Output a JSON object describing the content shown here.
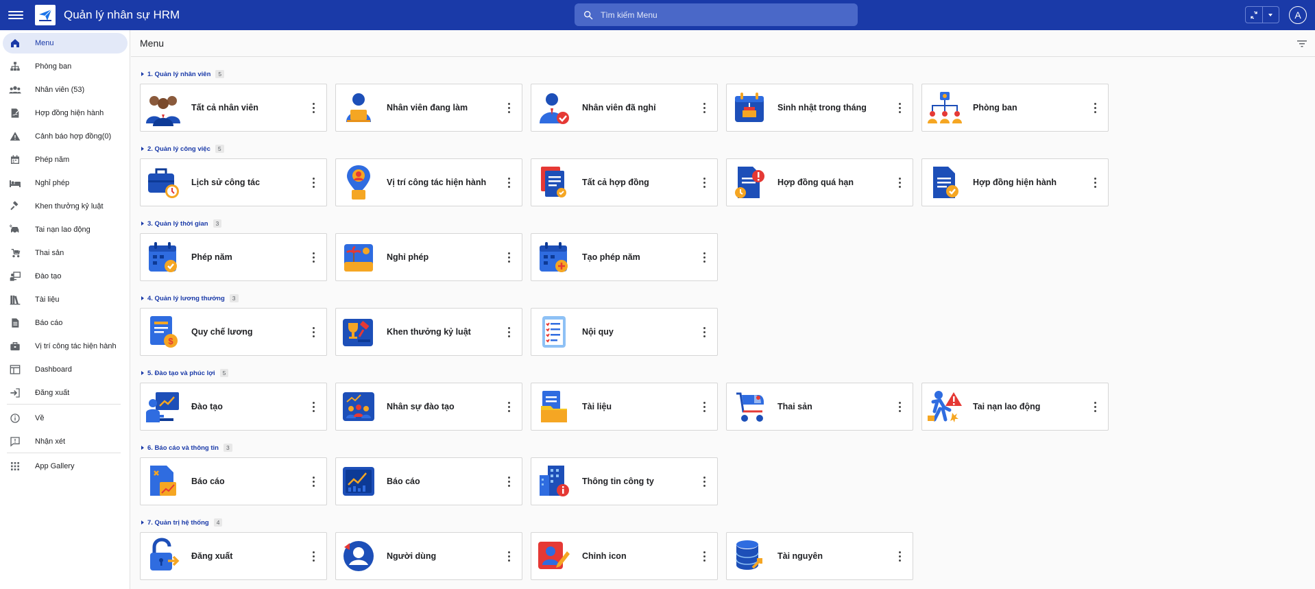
{
  "header": {
    "title": "Quản lý nhân sự HRM",
    "search_placeholder": "Tìm kiếm Menu",
    "avatar_letter": "A",
    "brand_color": "#1a3aa8"
  },
  "sidebar": {
    "items": [
      {
        "label": "Menu",
        "icon": "home-icon",
        "active": true
      },
      {
        "label": "Phòng ban",
        "icon": "org-chart-icon"
      },
      {
        "label": "Nhân viên (53)",
        "icon": "people-icon"
      },
      {
        "label": "Hợp đồng hiện hành",
        "icon": "contract-sign-icon"
      },
      {
        "label": "Cảnh báo hợp đồng(0)",
        "icon": "warning-icon"
      },
      {
        "label": "Phép năm",
        "icon": "calendar-icon"
      },
      {
        "label": "Nghỉ phép",
        "icon": "bed-icon"
      },
      {
        "label": "Khen thưởng kỷ luật",
        "icon": "gavel-icon"
      },
      {
        "label": "Tai nạn lao động",
        "icon": "car-crash-icon"
      },
      {
        "label": "Thai sản",
        "icon": "stroller-icon"
      },
      {
        "label": "Đào tạo",
        "icon": "teacher-icon"
      },
      {
        "label": "Tài liệu",
        "icon": "books-icon"
      },
      {
        "label": "Báo cáo",
        "icon": "report-icon"
      },
      {
        "label": "Vị trí công tác hiện hành",
        "icon": "briefcase-icon"
      },
      {
        "label": "Dashboard",
        "icon": "dashboard-icon"
      },
      {
        "label": "Đăng xuất",
        "icon": "logout-icon"
      }
    ],
    "footer_items": [
      {
        "label": "Về",
        "icon": "info-icon"
      },
      {
        "label": "Nhận xét",
        "icon": "feedback-icon"
      },
      {
        "label": "App Gallery",
        "icon": "apps-grid-icon"
      }
    ]
  },
  "main": {
    "title": "Menu",
    "sections": [
      {
        "title": "1. Quản lý nhân viên",
        "count": "5",
        "cards": [
          {
            "label": "Tất cả nhân viên",
            "icon": "team-icon"
          },
          {
            "label": "Nhân viên đang làm",
            "icon": "employee-laptop-icon"
          },
          {
            "label": "Nhân viên đã nghỉ",
            "icon": "employee-check-icon"
          },
          {
            "label": "Sinh nhật trong tháng",
            "icon": "birthday-calendar-icon"
          },
          {
            "label": "Phòng ban",
            "icon": "hierarchy-icon"
          }
        ]
      },
      {
        "title": "2. Quản lý công việc",
        "count": "5",
        "cards": [
          {
            "label": "Lịch sử công tác",
            "icon": "briefcase-clock-icon"
          },
          {
            "label": "Vị trí công tác hiện hành",
            "icon": "location-pin-icon"
          },
          {
            "label": "Tất cả hợp đồng",
            "icon": "documents-icon"
          },
          {
            "label": "Hợp đồng quá hạn",
            "icon": "document-overdue-icon"
          },
          {
            "label": "Hợp đồng hiện hành",
            "icon": "document-check-icon"
          }
        ]
      },
      {
        "title": "3. Quản lý thời gian",
        "count": "3",
        "cards": [
          {
            "label": "Phép năm",
            "icon": "calendar-check-icon"
          },
          {
            "label": "Nghỉ phép",
            "icon": "beach-icon"
          },
          {
            "label": "Tạo phép năm",
            "icon": "calendar-add-icon"
          }
        ]
      },
      {
        "title": "4. Quản lý lương thưởng",
        "count": "3",
        "cards": [
          {
            "label": "Quy chế lương",
            "icon": "salary-icon"
          },
          {
            "label": "Khen thưởng kỷ luật",
            "icon": "trophy-gavel-icon"
          },
          {
            "label": "Nội quy",
            "icon": "checklist-icon"
          }
        ]
      },
      {
        "title": "5. Đào tạo và phúc lợi",
        "count": "5",
        "cards": [
          {
            "label": "Đào tạo",
            "icon": "presentation-icon"
          },
          {
            "label": "Nhân sự đào tạo",
            "icon": "training-group-icon"
          },
          {
            "label": "Tài liệu",
            "icon": "folder-doc-icon"
          },
          {
            "label": "Thai sản",
            "icon": "baby-stroller-icon"
          },
          {
            "label": "Tai nạn lao động",
            "icon": "accident-icon"
          }
        ]
      },
      {
        "title": "6. Báo cáo và thông tin",
        "count": "3",
        "cards": [
          {
            "label": "Báo cáo",
            "icon": "report-chart-icon"
          },
          {
            "label": "Báo cáo",
            "icon": "dashboard-chart-icon"
          },
          {
            "label": "Thông tin công ty",
            "icon": "building-info-icon"
          }
        ]
      },
      {
        "title": "7. Quản trị hệ thống",
        "count": "4",
        "cards": [
          {
            "label": "Đăng xuất",
            "icon": "unlock-icon"
          },
          {
            "label": "Người dùng",
            "icon": "user-circle-icon"
          },
          {
            "label": "Chỉnh icon",
            "icon": "edit-profile-icon"
          },
          {
            "label": "Tài nguyên",
            "icon": "database-icon"
          }
        ]
      }
    ]
  }
}
